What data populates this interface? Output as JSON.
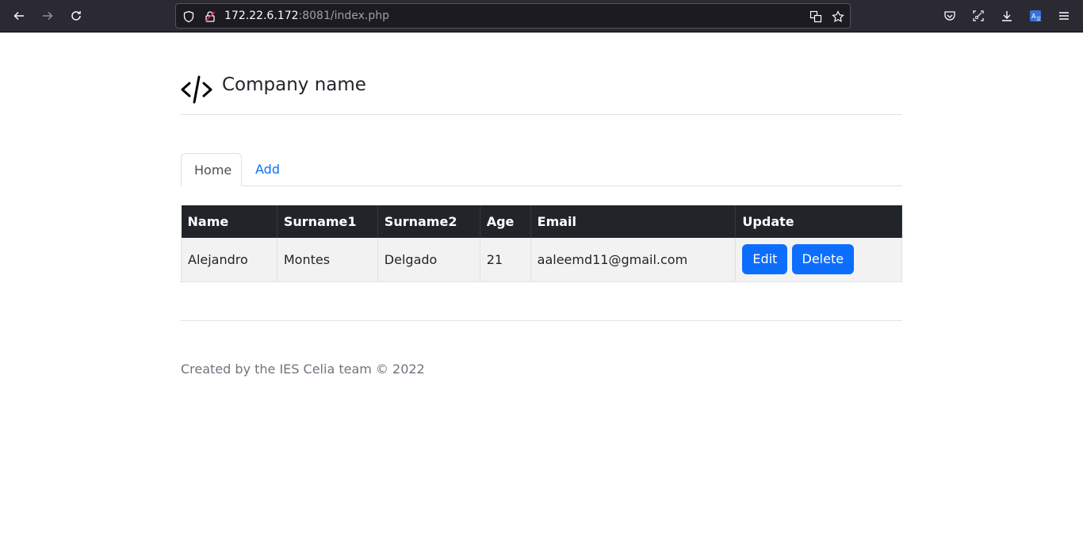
{
  "browser": {
    "url_host": "172.22.6.172",
    "url_rest": ":8081/index.php"
  },
  "header": {
    "brand": "Company name",
    "logo_icon": "code-slash-icon"
  },
  "tabs": [
    {
      "label": "Home",
      "active": true
    },
    {
      "label": "Add",
      "active": false
    }
  ],
  "table": {
    "columns": [
      "Name",
      "Surname1",
      "Surname2",
      "Age",
      "Email",
      "Update"
    ],
    "rows": [
      {
        "name": "Alejandro",
        "surname1": "Montes",
        "surname2": "Delgado",
        "age": "21",
        "email": "aaleemd11@gmail.com",
        "edit_label": "Edit",
        "delete_label": "Delete"
      }
    ]
  },
  "footer": {
    "text": "Created by the IES Celia team © 2022"
  },
  "colors": {
    "accent": "#0d6efd",
    "table_header": "#212529",
    "chrome": "#2b2a33"
  }
}
